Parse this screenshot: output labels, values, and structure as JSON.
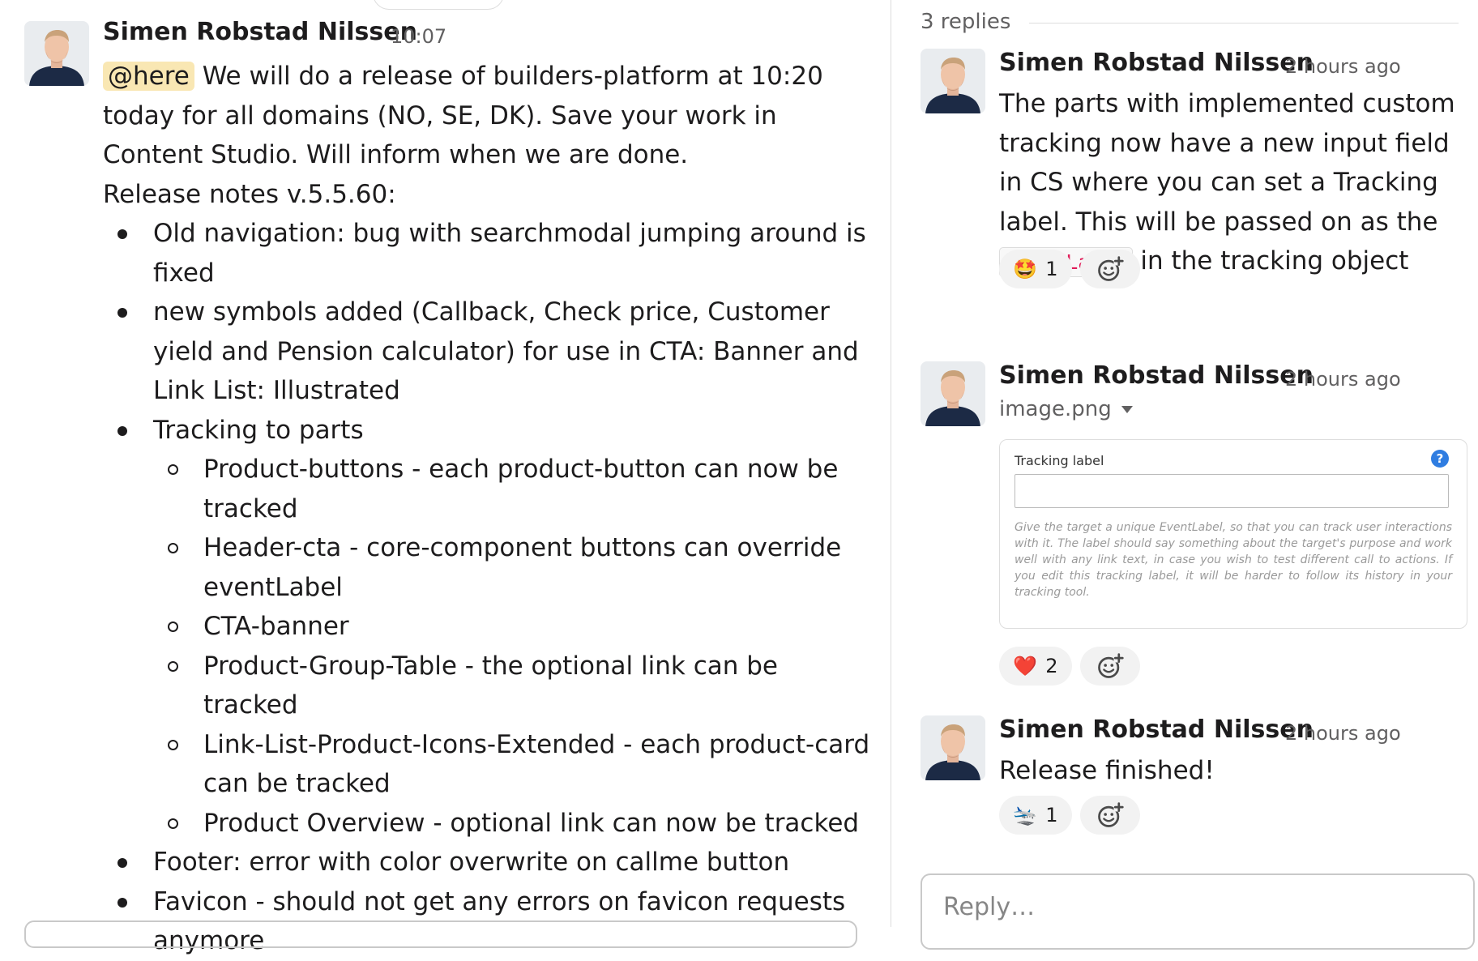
{
  "main_message": {
    "author": "Simen Robstad Nilssen",
    "time": "10:07",
    "mention": "@here",
    "intro": " We will do a release of builders-platform at 10:20 today for all domains (NO, SE, DK). Save your work in Content Studio. Will inform when we are done.",
    "notes_heading": "Release notes v.5.5.60:",
    "bullets": [
      "Old navigation: bug with searchmodal jumping around is fixed",
      "new symbols added (Callback, Check price, Customer yield and Pension calculator) for use in CTA: Banner and Link List: Illustrated",
      "Tracking to parts"
    ],
    "sub_bullets": [
      "Product-buttons - each product-button can now be tracked",
      "Header-cta - core-component buttons can override eventLabel",
      "CTA-banner",
      "Product-Group-Table - the optional link can be tracked",
      "Link-List-Product-Icons-Extended - each product-card can be tracked",
      "Product Overview - optional link can now be tracked"
    ],
    "bullets_after": [
      "Footer: error with color overwrite on callme button",
      "Favicon - should not get any errors on favicon requests anymore"
    ]
  },
  "thread": {
    "replies_count": "3 replies",
    "replies": [
      {
        "author": "Simen Robstad Nilssen",
        "time": "2 hours ago",
        "text_before": "The parts with implemented custom tracking now have a new input field in CS where you can set a Tracking label. This will be passed on as the ",
        "code": "eventLabel",
        "text_after": " in the tracking object",
        "reaction": {
          "emoji": "🤩",
          "count": "1"
        }
      },
      {
        "author": "Simen Robstad Nilssen",
        "time": "2 hours ago",
        "file_name": "image.png",
        "image": {
          "label": "Tracking label",
          "help_icon": "?",
          "help_text": "Give the target a unique EventLabel, so that you can track user interactions with it. The label should say something about the target's purpose and work well with any link text, in case you wish to test different call to actions. If you edit this tracking label, it will be harder to follow its history in your tracking tool."
        },
        "reaction": {
          "emoji": "❤️",
          "count": "2"
        }
      },
      {
        "author": "Simen Robstad Nilssen",
        "time": "2 hours ago",
        "text": "Release finished!",
        "reaction": {
          "emoji": "🛬",
          "count": "1"
        }
      }
    ],
    "reply_placeholder": "Reply…"
  },
  "colors": {
    "mention_bg": "#f9e7b3",
    "code_text": "#e01e5a",
    "help_blue": "#2f7de1"
  },
  "icons": {
    "avatar": "person-avatar",
    "add_reaction": "add-reaction-icon",
    "file_caret": "caret-down-icon",
    "help": "question-mark-icon"
  }
}
